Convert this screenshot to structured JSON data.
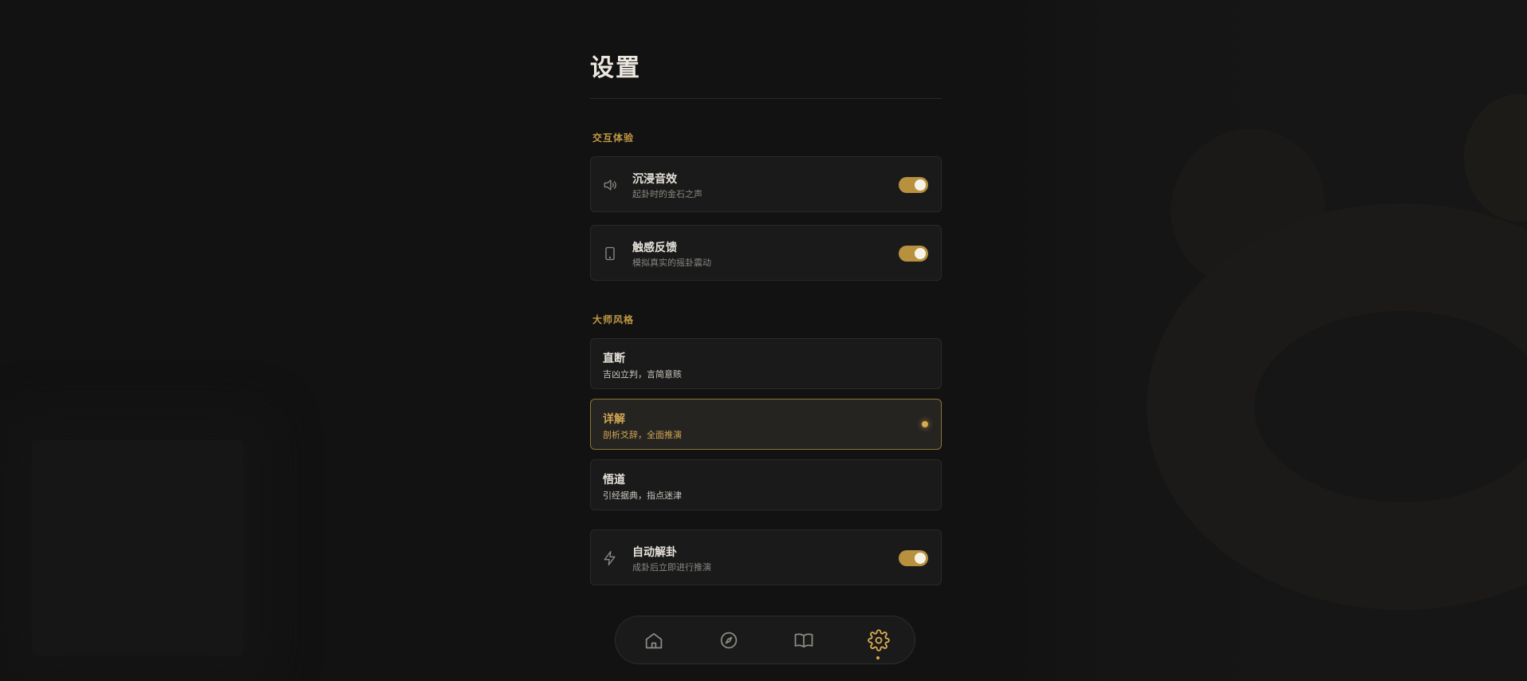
{
  "page": {
    "title": "设置"
  },
  "sections": {
    "interaction": {
      "label": "交互体验",
      "items": [
        {
          "title": "沉浸音效",
          "subtitle": "起卦时的金石之声",
          "icon": "speaker-icon",
          "enabled": true
        },
        {
          "title": "触感反馈",
          "subtitle": "模拟真实的摇卦震动",
          "icon": "phone-icon",
          "enabled": true
        }
      ]
    },
    "master_style": {
      "label": "大师风格",
      "options": [
        {
          "title": "直断",
          "subtitle": "吉凶立判，言简意赅",
          "selected": false
        },
        {
          "title": "详解",
          "subtitle": "剖析爻辞，全面推演",
          "selected": true
        },
        {
          "title": "悟道",
          "subtitle": "引经据典，指点迷津",
          "selected": false
        }
      ]
    },
    "auto": {
      "title": "自动解卦",
      "subtitle": "成卦后立即进行推演",
      "icon": "lightning-icon",
      "enabled": true
    }
  },
  "nav": {
    "items": [
      {
        "icon": "home-icon",
        "active": false
      },
      {
        "icon": "compass-icon",
        "active": false
      },
      {
        "icon": "book-icon",
        "active": false
      },
      {
        "icon": "gear-icon",
        "active": true
      }
    ]
  },
  "colors": {
    "accent": "#c29a45",
    "toggle_on": "#b8913f",
    "background": "#121212",
    "card": "#1a1a1a"
  }
}
